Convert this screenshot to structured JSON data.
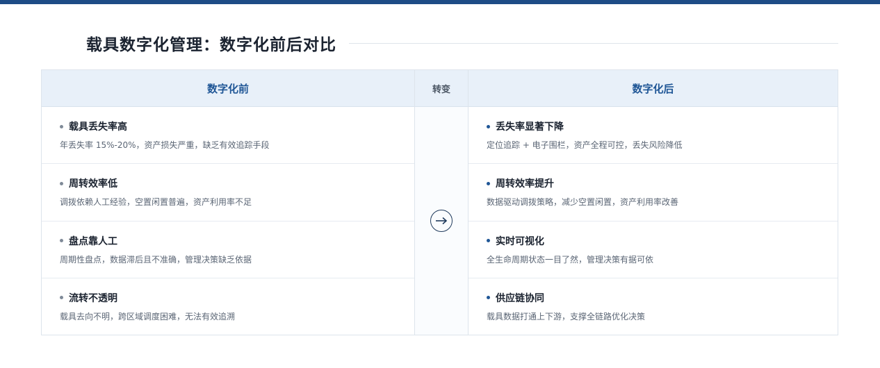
{
  "title": "载具数字化管理：数字化前后对比",
  "columns": {
    "before": "数字化前",
    "middle": "转变",
    "after": "数字化后"
  },
  "before_items": [
    {
      "title": "载具丢失率高",
      "desc": "年丢失率 15%-20%，资产损失严重，缺乏有效追踪手段"
    },
    {
      "title": "周转效率低",
      "desc": "调拨依赖人工经验，空置闲置普遍，资产利用率不足"
    },
    {
      "title": "盘点靠人工",
      "desc": "周期性盘点，数据滞后且不准确，管理决策缺乏依据"
    },
    {
      "title": "流转不透明",
      "desc": "载具去向不明，跨区域调度困难，无法有效追溯"
    }
  ],
  "after_items": [
    {
      "title": "丢失率显著下降",
      "desc": "定位追踪 + 电子围栏，资产全程可控，丢失风险降低"
    },
    {
      "title": "周转效率提升",
      "desc": "数据驱动调拨策略，减少空置闲置，资产利用率改善"
    },
    {
      "title": "实时可视化",
      "desc": "全生命周期状态一目了然，管理决策有据可依"
    },
    {
      "title": "供应链协同",
      "desc": "载具数据打通上下游，支撑全链路优化决策"
    }
  ],
  "icons": {
    "transition": "arrow-right-circle-icon"
  },
  "colors": {
    "accent": "#1f5696",
    "header_bg": "#e8f0f9",
    "top_bar": "#1e4c86"
  }
}
